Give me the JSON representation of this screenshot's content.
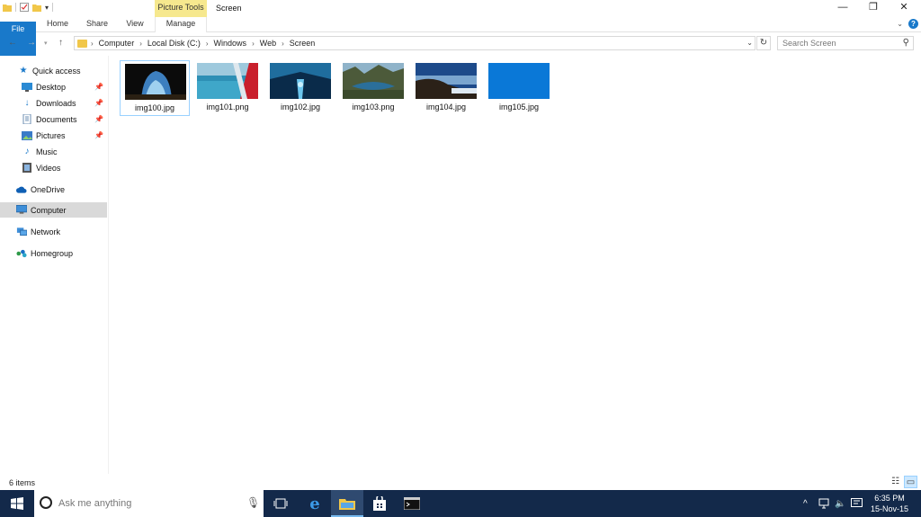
{
  "window": {
    "title": "Screen",
    "context_tab": "Picture Tools"
  },
  "ribbon": {
    "tabs": [
      {
        "label": "File"
      },
      {
        "label": "Home"
      },
      {
        "label": "Share"
      },
      {
        "label": "View"
      },
      {
        "label": "Manage"
      }
    ]
  },
  "address": {
    "crumbs": [
      "Computer",
      "Local Disk (C:)",
      "Windows",
      "Web",
      "Screen"
    ]
  },
  "search": {
    "placeholder": "Search Screen"
  },
  "sidebar": {
    "quick_access": "Quick access",
    "items": [
      {
        "label": "Desktop",
        "icon": "desktop-icon",
        "pinned": true
      },
      {
        "label": "Downloads",
        "icon": "download-arrow-icon",
        "pinned": true
      },
      {
        "label": "Documents",
        "icon": "documents-icon",
        "pinned": true
      },
      {
        "label": "Pictures",
        "icon": "pictures-icon",
        "pinned": true
      },
      {
        "label": "Music",
        "icon": "music-note-icon",
        "pinned": false
      },
      {
        "label": "Videos",
        "icon": "video-film-icon",
        "pinned": false
      }
    ],
    "onedrive": "OneDrive",
    "computer": "Computer",
    "network": "Network",
    "homegroup": "Homegroup"
  },
  "files": [
    {
      "name": "img100.jpg",
      "selected": true
    },
    {
      "name": "img101.png",
      "selected": false
    },
    {
      "name": "img102.jpg",
      "selected": false
    },
    {
      "name": "img103.png",
      "selected": false
    },
    {
      "name": "img104.jpg",
      "selected": false
    },
    {
      "name": "img105.jpg",
      "selected": false
    }
  ],
  "status": {
    "item_count": "6 items"
  },
  "taskbar": {
    "search_placeholder": "Ask me anything",
    "time": "6:35 PM",
    "date": "15-Nov-15"
  },
  "colors": {
    "accent": "#1979ca",
    "taskbar": "#13294a",
    "context_tab": "#f6e88e",
    "selection": "#99d1ff"
  }
}
